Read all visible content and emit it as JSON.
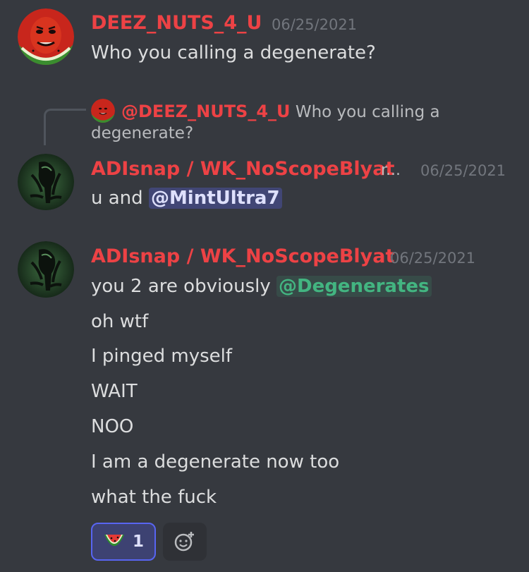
{
  "colors": {
    "background": "#36393f",
    "username_red": "#ed4245",
    "timestamp": "#72767d",
    "mention_user_bg": "#414675",
    "mention_role": "#43b581",
    "reaction_border": "#5865f2"
  },
  "messages": [
    {
      "author": "DEEZ_NUTS_4_U",
      "timestamp": "06/25/2021",
      "avatar_icon": "watermelon-face-avatar",
      "lines": [
        "Who you calling a degenerate?"
      ]
    },
    {
      "reply_to": {
        "mention": "@DEEZ_NUTS_4_U",
        "text_line1": "Who you calling a",
        "text_line2": "degenerate?"
      },
      "author": "ADIsnap / WK_NoScopeBlyat",
      "author_suffix": "r...",
      "timestamp": "06/25/2021",
      "avatar_icon": "alien-creature-avatar",
      "text_prefix": "u and",
      "mention": "@MintUltra7"
    },
    {
      "author": "ADIsnap / WK_NoScopeBlyat",
      "timestamp": "06/25/2021",
      "avatar_icon": "alien-creature-avatar",
      "first_prefix": "you 2 are obviously",
      "role_mention": "@Degenerates",
      "lines": [
        "oh wtf",
        "I pinged myself",
        "WAIT",
        "NOO",
        "I am a degenerate now too",
        "what the fuck"
      ],
      "reactions": [
        {
          "icon": "watermelon-emoji-icon",
          "count": "1"
        }
      ],
      "add_reaction_icon": "add-emoji-icon"
    }
  ]
}
